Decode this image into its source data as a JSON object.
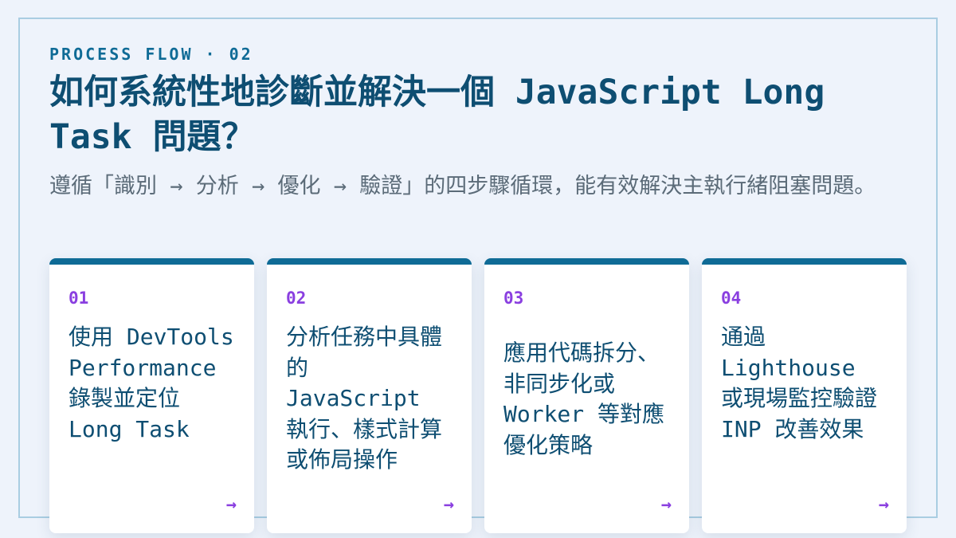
{
  "header": {
    "eyebrow": "PROCESS FLOW · 02",
    "title": "如何系統性地診斷並解決一個 JavaScript Long Task 問題？",
    "subtitle": "遵循「識別 → 分析 → 優化 → 驗證」的四步驟循環，能有效解決主執行緒阻塞問題。"
  },
  "steps": [
    {
      "number": "01",
      "text": "使用 DevTools Performance 錄製並定位 Long Task",
      "arrow": "→"
    },
    {
      "number": "02",
      "text": "分析任務中具體的 JavaScript 執行、樣式計算或佈局操作",
      "arrow": "→"
    },
    {
      "number": "03",
      "text": "應用代碼拆分、非同步化或 Worker 等對應優化策略",
      "arrow": "→"
    },
    {
      "number": "04",
      "text": "通過 Lighthouse 或現場監控驗證 INP 改善效果",
      "arrow": "→"
    }
  ],
  "colors": {
    "background": "#eef3fb",
    "accent": "#0f6b96",
    "title": "#0e4e72",
    "step_number": "#8a3fe0",
    "subtitle": "#5b6b78"
  }
}
